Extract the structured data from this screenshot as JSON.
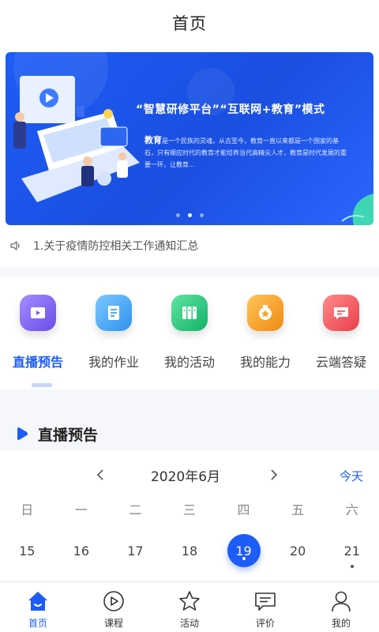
{
  "header": {
    "title": "首页"
  },
  "banner": {
    "title": "“智慧研修平台”“互联网+教育”模式",
    "desc_lead": "教育",
    "desc_body": "是一个民族的灵魂，从古至今，教育一直以来都是一个国家的基石，只有顺应时代的教育才能培养当代高精尖人才，教育是时代发展的重要一环，让教育...",
    "active_dot": 1
  },
  "notice": {
    "text": "1.关于疫情防控相关工作通知汇总"
  },
  "quick": [
    {
      "label": "直播预告",
      "icon": "live-preview-icon",
      "color": "#7b5cf0"
    },
    {
      "label": "我的作业",
      "icon": "homework-icon",
      "color": "#3fa7f5"
    },
    {
      "label": "我的活动",
      "icon": "activity-icon",
      "color": "#22c27a"
    },
    {
      "label": "我的能力",
      "icon": "ability-medal-icon",
      "color": "#f5a020"
    },
    {
      "label": "云端答疑",
      "icon": "cloud-qa-icon",
      "color": "#f25a5a"
    }
  ],
  "section": {
    "title": "直播预告"
  },
  "calendar": {
    "month": "2020年6月",
    "today_label": "今天",
    "weekdays": [
      "日",
      "一",
      "二",
      "三",
      "四",
      "五",
      "六"
    ],
    "days": [
      "15",
      "16",
      "17",
      "18",
      "19",
      "20",
      "21"
    ],
    "selected_day": "19",
    "marked_days": [
      "19",
      "21"
    ]
  },
  "tabbar": [
    {
      "label": "首页",
      "icon": "home-icon"
    },
    {
      "label": "课程",
      "icon": "play-course-icon"
    },
    {
      "label": "活动",
      "icon": "star-activity-icon"
    },
    {
      "label": "评价",
      "icon": "comment-icon"
    },
    {
      "label": "我的",
      "icon": "user-icon"
    }
  ],
  "colors": {
    "accent": "#1d5cf6"
  }
}
